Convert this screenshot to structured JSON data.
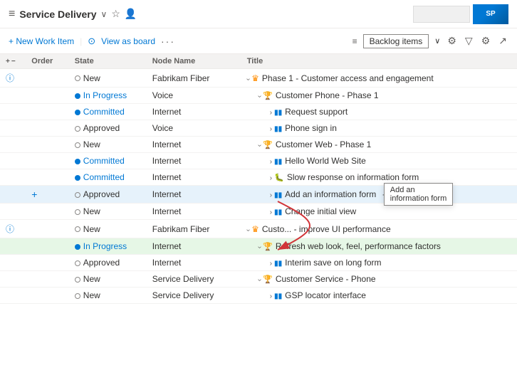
{
  "header": {
    "icon": "≡",
    "title": "Service Delivery",
    "chevron": "∨",
    "star_icon": "☆",
    "user_icon": "👤",
    "search_placeholder": ""
  },
  "toolbar": {
    "new_item_label": "+ New Work Item",
    "view_board_icon": "⊙",
    "view_board_label": "View as board",
    "more_icon": "···",
    "backlog_icon": "≡",
    "backlog_label": "Backlog items",
    "backlog_chevron": "∨",
    "filter_icon": "⚙",
    "settings_icon": "⚙",
    "expand_icon": "↗"
  },
  "columns": [
    {
      "id": "expand",
      "label": ""
    },
    {
      "id": "order",
      "label": "Order"
    },
    {
      "id": "state",
      "label": "State"
    },
    {
      "id": "node",
      "label": "Node Name"
    },
    {
      "id": "title",
      "label": "Title"
    }
  ],
  "rows": [
    {
      "id": 1,
      "expand_icon": "ⓘ",
      "order": "",
      "state_type": "new",
      "state_label": "New",
      "node": "Fabrikam Fiber",
      "indent": 1,
      "arrow": "chevron-down",
      "item_type": "epic",
      "title": "Phase 1 - Customer access and engagement",
      "highlighted": false
    },
    {
      "id": 2,
      "expand_icon": "",
      "order": "",
      "state_type": "inprogress",
      "state_label": "In Progress",
      "node": "Voice",
      "indent": 2,
      "arrow": "chevron-down",
      "item_type": "feature",
      "title": "Customer Phone - Phase 1",
      "highlighted": false
    },
    {
      "id": 3,
      "expand_icon": "",
      "order": "",
      "state_type": "committed",
      "state_label": "Committed",
      "node": "Internet",
      "indent": 3,
      "arrow": "chevron-right",
      "item_type": "story",
      "title": "Request support",
      "highlighted": false
    },
    {
      "id": 4,
      "expand_icon": "",
      "order": "",
      "state_type": "approved",
      "state_label": "Approved",
      "node": "Voice",
      "indent": 3,
      "arrow": "chevron-right",
      "item_type": "story",
      "title": "Phone sign in",
      "highlighted": false
    },
    {
      "id": 5,
      "expand_icon": "",
      "order": "",
      "state_type": "new",
      "state_label": "New",
      "node": "Internet",
      "indent": 2,
      "arrow": "chevron-down",
      "item_type": "feature",
      "title": "Customer Web - Phase 1",
      "highlighted": false
    },
    {
      "id": 6,
      "expand_icon": "",
      "order": "",
      "state_type": "committed",
      "state_label": "Committed",
      "node": "Internet",
      "indent": 3,
      "arrow": "chevron-right",
      "item_type": "story",
      "title": "Hello World Web Site",
      "highlighted": false
    },
    {
      "id": 7,
      "expand_icon": "",
      "order": "",
      "state_type": "committed",
      "state_label": "Committed",
      "node": "Internet",
      "indent": 3,
      "arrow": "chevron-right",
      "item_type": "bug",
      "title": "Slow response on information form",
      "highlighted": false
    },
    {
      "id": 8,
      "expand_icon": "",
      "order": "",
      "state_type": "approved",
      "state_label": "Approved",
      "node": "Internet",
      "indent": 3,
      "arrow": "chevron-right",
      "item_type": "story",
      "title": "Add an information form",
      "has_ellipsis": true,
      "highlighted": true,
      "show_tooltip": true,
      "tooltip_text": "Add an information form"
    },
    {
      "id": 9,
      "expand_icon": "",
      "order": "",
      "state_type": "new",
      "state_label": "New",
      "node": "Internet",
      "indent": 3,
      "arrow": "chevron-right",
      "item_type": "story",
      "title": "Change initial view",
      "highlighted": false
    },
    {
      "id": 10,
      "expand_icon": "ⓘ",
      "order": "",
      "state_type": "new",
      "state_label": "New",
      "node": "Fabrikam Fiber",
      "indent": 1,
      "arrow": "chevron-down",
      "item_type": "epic",
      "title": "Custo... - improve UI performance",
      "highlighted": false
    },
    {
      "id": 11,
      "expand_icon": "",
      "order": "",
      "state_type": "inprogress",
      "state_label": "In Progress",
      "node": "Internet",
      "indent": 2,
      "arrow": "chevron-down",
      "item_type": "feature",
      "title": "Refresh web look, feel, performance factors",
      "highlighted": true,
      "row_green": true
    },
    {
      "id": 12,
      "expand_icon": "",
      "order": "",
      "state_type": "approved",
      "state_label": "Approved",
      "node": "Internet",
      "indent": 3,
      "arrow": "chevron-right",
      "item_type": "story",
      "title": "Interim save on long form",
      "highlighted": false
    },
    {
      "id": 13,
      "expand_icon": "",
      "order": "",
      "state_type": "new",
      "state_label": "New",
      "node": "Service Delivery",
      "indent": 2,
      "arrow": "chevron-down",
      "item_type": "feature",
      "title": "Customer Service - Phone",
      "highlighted": false
    },
    {
      "id": 14,
      "expand_icon": "",
      "order": "",
      "state_type": "new",
      "state_label": "New",
      "node": "Service Delivery",
      "indent": 3,
      "arrow": "chevron-right",
      "item_type": "story",
      "title": "GSP locator interface",
      "highlighted": false
    }
  ],
  "tooltip": {
    "text": "Add an\ninformation form"
  }
}
